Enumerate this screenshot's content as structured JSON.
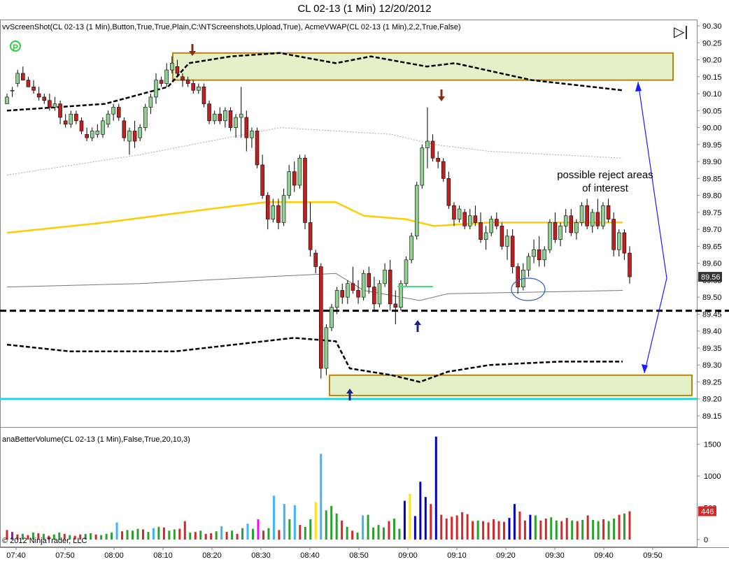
{
  "title": "CL 02-13 (1 Min)  12/20/2012",
  "indicator_label": "vvScreenShot(CL 02-13 (1 Min),Button,True,True,Plain,C:\\NTScreenshots,Upload,True), AcmeVWAP(CL 02-13 (1 Min),2,2,True,False)",
  "volume_label": "anaBetterVolume(CL 02-13 (1 Min),False,True,20,10,3)",
  "copyright": "© 2012 NinjaTrader, LLC",
  "annotation": [
    "possible reject areas",
    "of interest"
  ],
  "colors": {
    "up_candle": "#90d090",
    "down_candle": "#c02020",
    "vwap": "#ffcc00",
    "band": "#000000",
    "zone_fill": "#e4f0c8",
    "zone_border": "#b8860b",
    "cyan_line": "#00e5ee",
    "arrow_red": "#8b2a10",
    "arrow_blue": "#1a237e",
    "annotation_arrow": "#1a1aff"
  },
  "icons": [
    "ninja-logo-icon",
    "play-skip-icon"
  ],
  "chart_data": [
    {
      "type": "candlestick",
      "price_axis": {
        "ticks": [
          "90.30",
          "90.25",
          "90.20",
          "90.15",
          "90.10",
          "90.05",
          "90.00",
          "89.95",
          "89.90",
          "89.85",
          "89.80",
          "89.75",
          "89.70",
          "89.65",
          "89.60",
          "89.55",
          "89.50",
          "89.45",
          "89.40",
          "89.35",
          "89.30",
          "89.25",
          "89.20",
          "89.15"
        ],
        "ylim": [
          89.12,
          90.32
        ],
        "last_price_label": "89.56"
      },
      "time_axis": {
        "ticks": [
          "07:40",
          "07:50",
          "08:00",
          "08:10",
          "08:20",
          "08:30",
          "08:40",
          "08:50",
          "09:00",
          "09:10",
          "09:20",
          "09:30",
          "09:40",
          "09:50"
        ]
      },
      "ohlc": [
        [
          90.07,
          90.1,
          90.07,
          90.09
        ],
        [
          90.11,
          90.12,
          90.09,
          90.11
        ],
        [
          90.13,
          90.17,
          90.12,
          90.16
        ],
        [
          90.16,
          90.18,
          90.14,
          90.14
        ],
        [
          90.14,
          90.15,
          90.12,
          90.12
        ],
        [
          90.12,
          90.14,
          90.1,
          90.11
        ],
        [
          90.1,
          90.12,
          90.08,
          90.09
        ],
        [
          90.09,
          90.1,
          90.07,
          90.08
        ],
        [
          90.08,
          90.1,
          90.05,
          90.06
        ],
        [
          90.06,
          90.09,
          90.05,
          90.07
        ],
        [
          90.07,
          90.08,
          90.01,
          90.03
        ],
        [
          90.02,
          90.04,
          90.0,
          90.01
        ],
        [
          90.01,
          90.05,
          90.0,
          90.04
        ],
        [
          90.04,
          90.05,
          90.01,
          90.02
        ],
        [
          90.02,
          90.03,
          89.98,
          89.99
        ],
        [
          89.98,
          90.0,
          89.96,
          89.97
        ],
        [
          89.97,
          90.0,
          89.96,
          89.99
        ],
        [
          89.98,
          90.01,
          89.97,
          89.99
        ],
        [
          89.98,
          90.03,
          89.97,
          90.02
        ],
        [
          90.01,
          90.05,
          90.0,
          90.04
        ],
        [
          90.04,
          90.07,
          90.02,
          90.06
        ],
        [
          90.06,
          90.07,
          90.02,
          90.03
        ],
        [
          90.02,
          90.03,
          89.96,
          89.97
        ],
        [
          89.96,
          90.0,
          89.92,
          89.99
        ],
        [
          89.99,
          90.02,
          89.94,
          89.96
        ],
        [
          89.97,
          90.01,
          89.96,
          90.0
        ],
        [
          90.0,
          90.07,
          89.99,
          90.06
        ],
        [
          90.06,
          90.1,
          90.04,
          90.09
        ],
        [
          90.09,
          90.16,
          90.07,
          90.14
        ],
        [
          90.14,
          90.15,
          90.12,
          90.13
        ],
        [
          90.13,
          90.19,
          90.12,
          90.17
        ],
        [
          90.17,
          90.21,
          90.16,
          90.19
        ],
        [
          90.18,
          90.2,
          90.15,
          90.16
        ],
        [
          90.15,
          90.16,
          90.12,
          90.14
        ],
        [
          90.14,
          90.15,
          90.12,
          90.13
        ],
        [
          90.13,
          90.14,
          90.1,
          90.11
        ],
        [
          90.11,
          90.13,
          90.1,
          90.12
        ],
        [
          90.12,
          90.13,
          90.06,
          90.07
        ],
        [
          90.07,
          90.08,
          90.01,
          90.02
        ],
        [
          90.02,
          90.05,
          90.01,
          90.04
        ],
        [
          90.04,
          90.06,
          90.01,
          90.02
        ],
        [
          90.02,
          90.06,
          90.0,
          90.05
        ],
        [
          90.05,
          90.06,
          89.99,
          90.0
        ],
        [
          90.0,
          90.04,
          89.97,
          90.03
        ],
        [
          90.03,
          90.12,
          89.97,
          90.04
        ],
        [
          90.03,
          90.05,
          89.93,
          89.97
        ],
        [
          89.97,
          90.0,
          89.94,
          89.99
        ],
        [
          89.99,
          90.0,
          89.88,
          89.89
        ],
        [
          89.89,
          89.92,
          89.79,
          89.8
        ],
        [
          89.8,
          89.81,
          89.7,
          89.73
        ],
        [
          89.73,
          89.79,
          89.72,
          89.77
        ],
        [
          89.77,
          89.79,
          89.7,
          89.72
        ],
        [
          89.72,
          89.82,
          89.71,
          89.8
        ],
        [
          89.8,
          89.89,
          89.79,
          89.87
        ],
        [
          89.87,
          89.9,
          89.81,
          89.83
        ],
        [
          89.83,
          89.92,
          89.82,
          89.91
        ],
        [
          89.91,
          89.92,
          89.7,
          89.72
        ],
        [
          89.72,
          89.78,
          89.62,
          89.64
        ],
        [
          89.63,
          89.64,
          89.57,
          89.59
        ],
        [
          89.59,
          89.6,
          89.26,
          89.29
        ],
        [
          89.29,
          89.42,
          89.27,
          89.41
        ],
        [
          89.41,
          89.48,
          89.4,
          89.47
        ],
        [
          89.47,
          89.53,
          89.45,
          89.52
        ],
        [
          89.52,
          89.54,
          89.48,
          89.5
        ],
        [
          89.5,
          89.55,
          89.48,
          89.54
        ],
        [
          89.54,
          89.59,
          89.51,
          89.52
        ],
        [
          89.52,
          89.55,
          89.48,
          89.5
        ],
        [
          89.5,
          89.58,
          89.49,
          89.57
        ],
        [
          89.57,
          89.59,
          89.51,
          89.53
        ],
        [
          89.53,
          89.56,
          89.46,
          89.48
        ],
        [
          89.48,
          89.55,
          89.47,
          89.54
        ],
        [
          89.54,
          89.6,
          89.53,
          89.58
        ],
        [
          89.58,
          89.61,
          89.46,
          89.48
        ],
        [
          89.48,
          89.52,
          89.42,
          89.47
        ],
        [
          89.47,
          89.55,
          89.46,
          89.54
        ],
        [
          89.54,
          89.62,
          89.53,
          89.61
        ],
        [
          89.61,
          89.69,
          89.6,
          89.68
        ],
        [
          89.68,
          89.84,
          89.67,
          89.83
        ],
        [
          89.83,
          89.95,
          89.82,
          89.94
        ],
        [
          89.94,
          90.06,
          89.88,
          89.96
        ],
        [
          89.96,
          89.98,
          89.9,
          89.91
        ],
        [
          89.91,
          89.93,
          89.88,
          89.9
        ],
        [
          89.9,
          89.91,
          89.84,
          89.85
        ],
        [
          89.85,
          89.87,
          89.76,
          89.77
        ],
        [
          89.77,
          89.78,
          89.71,
          89.73
        ],
        [
          89.73,
          89.77,
          89.72,
          89.76
        ],
        [
          89.75,
          89.76,
          89.7,
          89.71
        ],
        [
          89.71,
          89.76,
          89.7,
          89.74
        ],
        [
          89.74,
          89.77,
          89.71,
          89.72
        ],
        [
          89.72,
          89.75,
          89.66,
          89.67
        ],
        [
          89.67,
          89.71,
          89.64,
          89.69
        ],
        [
          89.69,
          89.74,
          89.68,
          89.73
        ],
        [
          89.73,
          89.75,
          89.7,
          89.71
        ],
        [
          89.71,
          89.72,
          89.64,
          89.65
        ],
        [
          89.65,
          89.7,
          89.61,
          89.68
        ],
        [
          89.68,
          89.7,
          89.57,
          89.59
        ],
        [
          89.59,
          89.6,
          89.51,
          89.53
        ],
        [
          89.53,
          89.6,
          89.52,
          89.58
        ],
        [
          89.58,
          89.63,
          89.56,
          89.62
        ],
        [
          89.62,
          89.67,
          89.6,
          89.64
        ],
        [
          89.64,
          89.68,
          89.59,
          89.61
        ],
        [
          89.61,
          89.65,
          89.59,
          89.64
        ],
        [
          89.64,
          89.73,
          89.63,
          89.72
        ],
        [
          89.72,
          89.75,
          89.66,
          89.67
        ],
        [
          89.67,
          89.72,
          89.65,
          89.71
        ],
        [
          89.71,
          89.76,
          89.69,
          89.74
        ],
        [
          89.74,
          89.76,
          89.68,
          89.69
        ],
        [
          89.69,
          89.73,
          89.67,
          89.72
        ],
        [
          89.72,
          89.78,
          89.71,
          89.77
        ],
        [
          89.77,
          89.79,
          89.7,
          89.71
        ],
        [
          89.71,
          89.76,
          89.69,
          89.75
        ],
        [
          89.75,
          89.79,
          89.7,
          89.71
        ],
        [
          89.71,
          89.78,
          89.7,
          89.77
        ],
        [
          89.77,
          89.79,
          89.72,
          89.73
        ],
        [
          89.73,
          89.75,
          89.62,
          89.64
        ],
        [
          89.64,
          89.7,
          89.62,
          89.69
        ],
        [
          89.69,
          89.7,
          89.61,
          89.63
        ],
        [
          89.63,
          89.65,
          89.54,
          89.56
        ]
      ],
      "vwap": {
        "start": 89.69,
        "end": 89.72,
        "max": 89.78
      },
      "bands": {
        "upper": {
          "start": 90.05,
          "end": 90.11
        },
        "lower": {
          "start": 89.36,
          "end": 89.31
        },
        "inner_upper": {
          "start": 89.86,
          "end": 89.91
        },
        "inner_lower": {
          "start": 89.53,
          "end": 89.52
        }
      },
      "lines": {
        "dashed_horizontal": 89.46,
        "cyan_horizontal": 89.2
      },
      "zones": [
        {
          "name": "upper-reject-zone",
          "top": 90.22,
          "bottom": 90.14
        },
        {
          "name": "lower-reject-zone",
          "top": 89.27,
          "bottom": 89.21
        }
      ]
    },
    {
      "type": "bar",
      "title": "anaBetterVolume",
      "volume_axis": {
        "ticks": [
          "1500",
          "1000",
          "500",
          "0"
        ],
        "ylim": [
          0,
          1650
        ],
        "last_value_label": "446"
      },
      "series_colors": {
        "green": "#2ca02c",
        "red": "#d62728",
        "blue": "#0000c8",
        "cyan": "#3cb4ff",
        "yellow": "#ffe119",
        "magenta": "#ff00ff",
        "purple": "#7f2a9f"
      },
      "values": [
        150,
        120,
        80,
        90,
        70,
        110,
        100,
        90,
        60,
        80,
        110,
        90,
        70,
        60,
        80,
        90,
        100,
        80,
        70,
        90,
        110,
        270,
        130,
        150,
        140,
        170,
        160,
        120,
        180,
        200,
        190,
        140,
        160,
        170,
        290,
        110,
        120,
        140,
        90,
        100,
        130,
        210,
        120,
        140,
        90,
        180,
        250,
        170,
        320,
        140,
        180,
        690,
        150,
        560,
        320,
        540,
        230,
        200,
        320,
        590,
        1350,
        460,
        530,
        410,
        300,
        200,
        140,
        110,
        380,
        390,
        190,
        230,
        190,
        290,
        330,
        170,
        610,
        720,
        370,
        910,
        670,
        560,
        1620,
        390,
        330,
        360,
        380,
        430,
        400,
        290,
        300,
        290,
        270,
        320,
        290,
        280,
        340,
        560,
        440,
        300,
        390,
        380,
        300,
        330,
        350,
        300,
        290,
        340,
        300,
        290,
        310,
        380,
        310,
        290,
        320,
        290,
        330,
        390,
        410,
        446
      ],
      "bar_colors": [
        "red",
        "purple",
        "red",
        "green",
        "red",
        "green",
        "red",
        "green",
        "red",
        "green",
        "green",
        "red",
        "green",
        "red",
        "red",
        "green",
        "green",
        "red",
        "green",
        "green",
        "green",
        "cyan",
        "red",
        "green",
        "green",
        "green",
        "red",
        "green",
        "cyan",
        "green",
        "red",
        "green",
        "green",
        "red",
        "red",
        "green",
        "red",
        "green",
        "red",
        "red",
        "green",
        "cyan",
        "red",
        "green",
        "red",
        "green",
        "cyan",
        "green",
        "magenta",
        "red",
        "green",
        "cyan",
        "red",
        "cyan",
        "green",
        "cyan",
        "red",
        "green",
        "green",
        "yellow",
        "cyan",
        "green",
        "green",
        "green",
        "red",
        "green",
        "red",
        "green",
        "cyan",
        "green",
        "green",
        "green",
        "green",
        "red",
        "green",
        "green",
        "blue",
        "yellow",
        "blue",
        "blue",
        "blue",
        "red",
        "blue",
        "red",
        "red",
        "red",
        "red",
        "red",
        "red",
        "red",
        "green",
        "red",
        "red",
        "red",
        "red",
        "red",
        "blue",
        "blue",
        "red",
        "red",
        "blue",
        "green",
        "red",
        "red",
        "green",
        "green",
        "red",
        "red",
        "green",
        "red",
        "green",
        "red",
        "green",
        "green",
        "red",
        "green",
        "green",
        "red",
        "green",
        "red",
        "red",
        "red"
      ]
    }
  ]
}
